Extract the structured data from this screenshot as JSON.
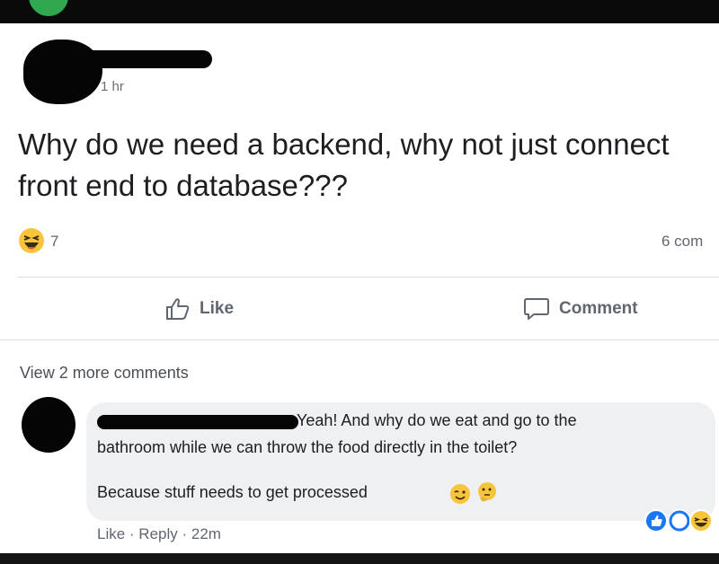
{
  "post": {
    "timestamp": "1 hr",
    "text": "Why do we need a backend, why not just connect front end to database???",
    "reaction_icon": "haha-emoji-icon",
    "reaction_count": "7",
    "comment_count": "6 com"
  },
  "actions": {
    "like_label": "Like",
    "comment_label": "Comment"
  },
  "comments": {
    "view_more": "View 2 more comments",
    "comment": {
      "text_line1": "Yeah! And why do we eat and go to the",
      "text_line2": "bathroom while we can throw the food directly in the toilet?",
      "text_line3": "Because stuff needs to get processed",
      "like": "Like",
      "reply": "Reply",
      "time": "22m",
      "separator": " · "
    }
  },
  "colors": {
    "like_blue": "#1877f2",
    "emoji_yellow": "#f7c53b",
    "text": "#1c1e21",
    "muted": "#606770"
  }
}
